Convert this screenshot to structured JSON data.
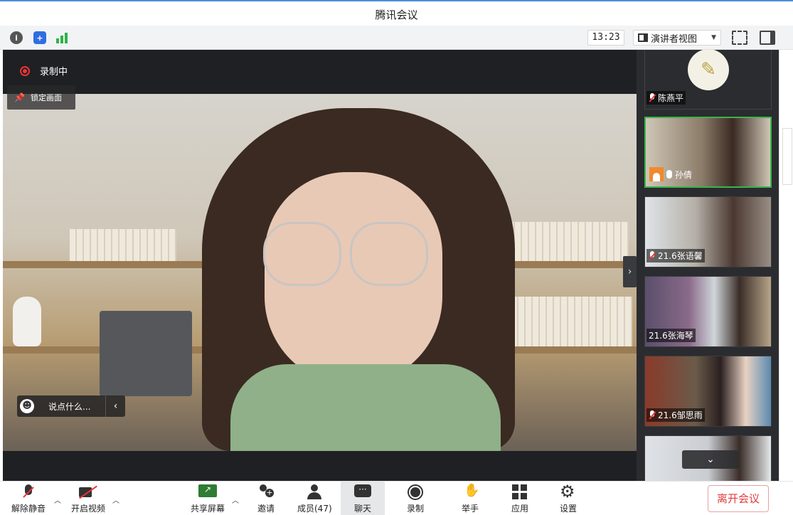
{
  "window": {
    "title": "腾讯会议"
  },
  "toolbar": {
    "time": "13:23",
    "view_label": "演讲者视图"
  },
  "stage": {
    "recording_label": "录制中",
    "lock_label": "锁定画面",
    "chat_placeholder": "说点什么..."
  },
  "participants": [
    {
      "name": "陈燕平",
      "muted": true
    },
    {
      "name": "孙倩",
      "muted": false,
      "host": true,
      "speaking": true
    },
    {
      "name": "21.6张语馨",
      "muted": true
    },
    {
      "name": "21.6张海琴",
      "muted": false
    },
    {
      "name": "21.6邹思雨",
      "muted": true
    }
  ],
  "bottombar": {
    "unmute": "解除静音",
    "start_video": "开启视频",
    "share_screen": "共享屏幕",
    "invite": "邀请",
    "members": "成员(47)",
    "chat": "聊天",
    "record": "录制",
    "raise_hand": "举手",
    "apps": "应用",
    "settings": "设置",
    "leave": "离开会议"
  },
  "colors": {
    "active_border": "#39b54a",
    "record_red": "#e33",
    "leave_red": "#e23c3c"
  }
}
